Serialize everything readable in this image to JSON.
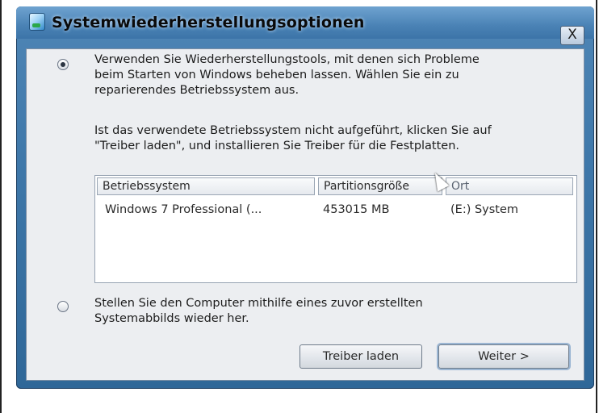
{
  "window": {
    "title": "Systemwiederherstellungsoptionen",
    "close_glyph": "X"
  },
  "option1": {
    "selected": true,
    "paragraph1": "Verwenden Sie Wiederherstellungstools, mit denen sich Probleme\nbeim Starten von Windows beheben lassen. Wählen Sie ein zu\nreparierendes Betriebssystem aus.",
    "paragraph2": "Ist das verwendete Betriebssystem nicht aufgeführt, klicken Sie auf\n\"Treiber laden\", und installieren Sie Treiber für die Festplatten."
  },
  "os_table": {
    "headers": {
      "os": "Betriebssystem",
      "size": "Partitionsgröße",
      "location": "Ort"
    },
    "rows": [
      {
        "os": "Windows 7 Professional (...",
        "size": "453015 MB",
        "location": "(E:) System"
      }
    ]
  },
  "option2": {
    "selected": false,
    "text": "Stellen Sie den Computer mithilfe eines zuvor erstellten\nSystemabbilds wieder her."
  },
  "buttons": {
    "load_drivers": "Treiber laden",
    "next": "Weiter >"
  },
  "icons": {
    "title_icon": "system-recovery-icon",
    "close_icon": "close-icon",
    "cursor": "mouse-cursor-icon"
  }
}
